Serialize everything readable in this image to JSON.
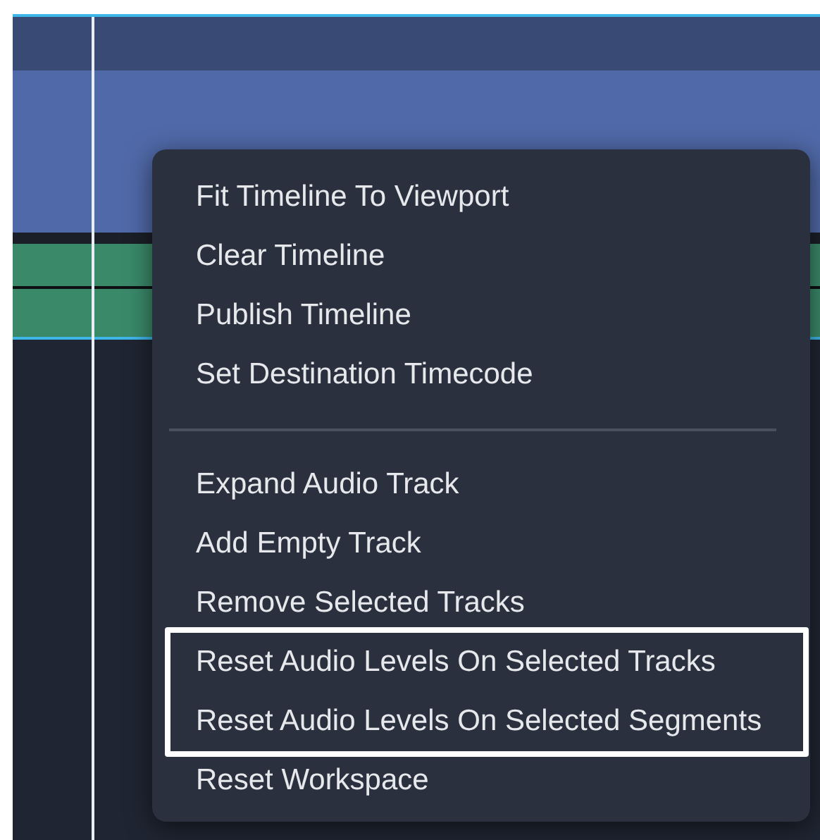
{
  "context_menu": {
    "sections": [
      {
        "items": [
          {
            "label": "Fit Timeline To Viewport",
            "highlighted": false
          },
          {
            "label": "Clear Timeline",
            "highlighted": false
          },
          {
            "label": "Publish Timeline",
            "highlighted": false
          },
          {
            "label": "Set Destination Timecode",
            "highlighted": false
          }
        ]
      },
      {
        "items": [
          {
            "label": "Expand Audio Track",
            "highlighted": false
          },
          {
            "label": "Add Empty Track",
            "highlighted": false
          },
          {
            "label": "Remove Selected Tracks",
            "highlighted": false
          },
          {
            "label": "Reset Audio Levels On Selected Tracks",
            "highlighted": true
          },
          {
            "label": "Reset Audio Levels On Selected Segments",
            "highlighted": true
          },
          {
            "label": "Reset Workspace",
            "highlighted": false
          }
        ]
      }
    ]
  }
}
